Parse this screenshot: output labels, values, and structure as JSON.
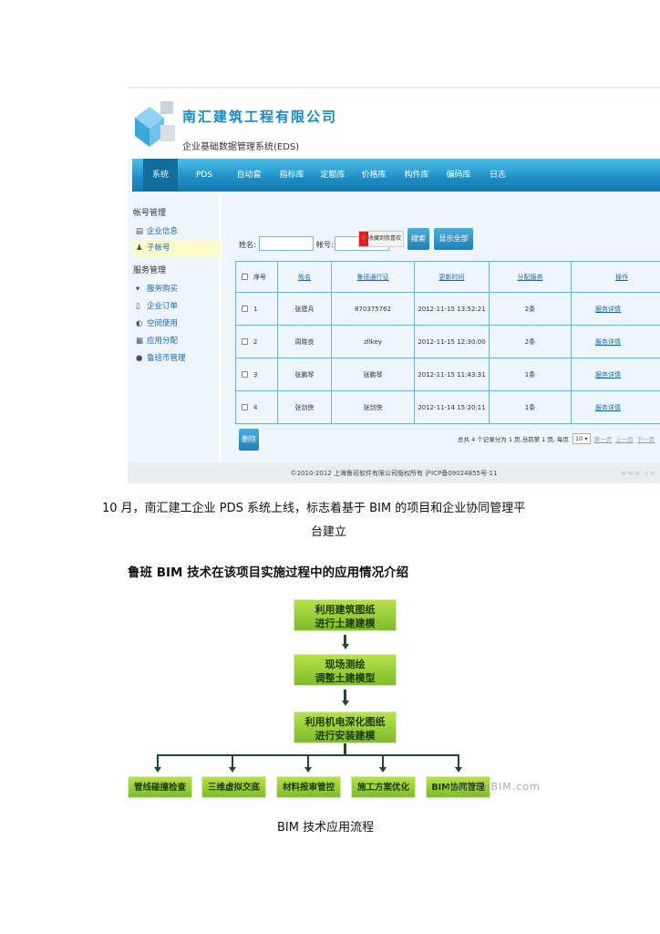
{
  "screenshot": {
    "company": "南汇建筑工程有限公司",
    "system_name": "企业基础数据管理系统(EDS)",
    "nav": [
      "系统",
      "PDS",
      "自动套",
      "指标库",
      "定额库",
      "价格库",
      "构件库",
      "编码库",
      "日志"
    ],
    "sidebar": {
      "group1": "帐号管理",
      "group1_items": [
        "企业信息",
        "子帐号"
      ],
      "group2": "服务管理",
      "group2_items": [
        "服务购买",
        "企业订单",
        "空间使用",
        "应用分配",
        "鲁班币管理"
      ]
    },
    "search": {
      "name_label": "姓名:",
      "account_label": "帐号:",
      "popup": "收藏到我喜欢",
      "search_btn": "搜索",
      "show_all_btn": "显示全部"
    },
    "table": {
      "headers": [
        "序号",
        "姓名",
        "鲁班通行证",
        "更新时间",
        "分配服务",
        "操作"
      ],
      "rows": [
        [
          "1",
          "张建兵",
          "870375762",
          "2012-11-15 13:52:21",
          "2条",
          "服务详情"
        ],
        [
          "2",
          "周晓良",
          "zllkey",
          "2012-11-15 12:30:00",
          "2条",
          "服务详情"
        ],
        [
          "3",
          "张鹏琴",
          "张鹏琴",
          "2012-11-15 11:43:31",
          "1条",
          "服务详情"
        ],
        [
          "4",
          "张剑侠",
          "张剑侠",
          "2012-11-14 15:20:11",
          "1条",
          "服务详情"
        ]
      ]
    },
    "delete_btn": "删除",
    "pagination": {
      "text": "总共 4 个记录分为 1 页,当前第 1 页, 每页",
      "per_page": "10",
      "first": "第一页",
      "prev": "上一页",
      "next": "下一页"
    },
    "footer": "©2010-2012 上海鲁班软件有限公司版权所有  沪ICP备09024855号-11",
    "watermark": "www.cn"
  },
  "caption1_line1": "10 月，南汇建工企业 PDS 系统上线，标志着基于 BIM 的项目和企业协同管理平",
  "caption1_line2": "台建立",
  "heading": "鲁班 BIM 技术在该项目实施过程中的应用情况介绍",
  "flow": {
    "steps": [
      [
        "利用建筑图纸",
        "进行土建建模"
      ],
      [
        "现场测绘",
        "调整土建模型"
      ],
      [
        "利用机电深化图纸",
        "进行安装建模"
      ]
    ],
    "branches": [
      "管线碰撞检查",
      "三维虚拟交底",
      "材料报审管控",
      "施工方案优化",
      "BIM协同管理"
    ],
    "watermark": "www.cnBIM.com"
  },
  "caption2": "BIM 技术应用流程"
}
